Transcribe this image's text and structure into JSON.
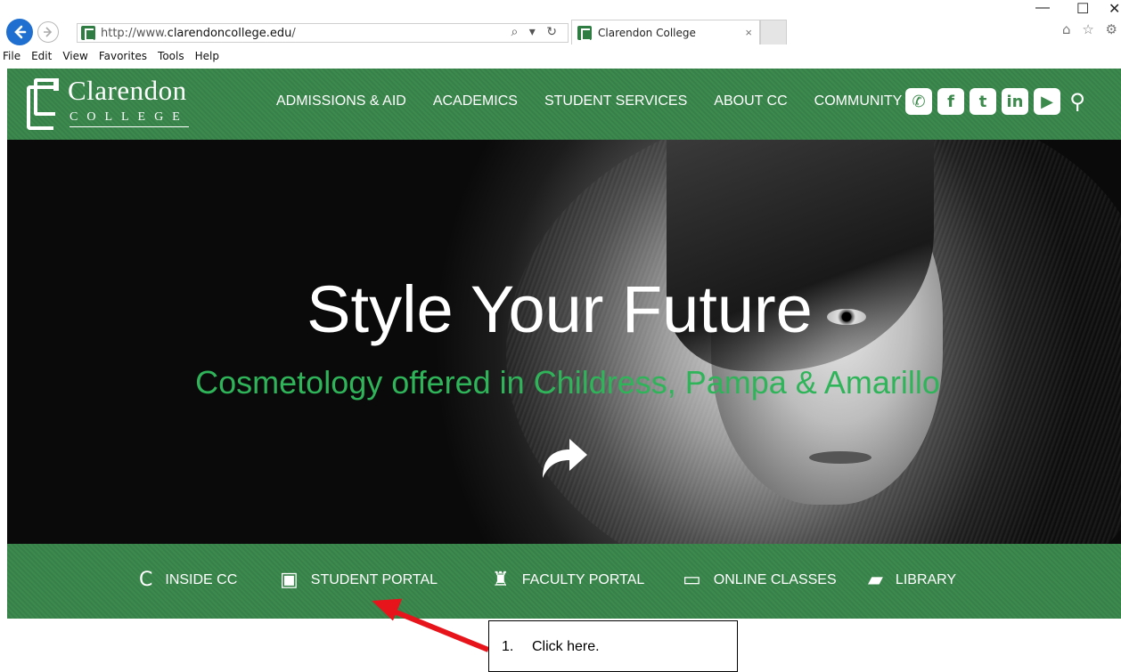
{
  "browser": {
    "url_prefix": "http://www.",
    "url_domain": "clarendoncollege.edu",
    "url_suffix": "/",
    "address_tools": "⌕ ▾ ↻",
    "tab_title": "Clarendon College",
    "tab_close": "×",
    "window_controls": {
      "minimize": "—",
      "maximize": "☐",
      "close": "✕"
    },
    "toolbar_icons": "⌂ ☆ ⚙",
    "menu": [
      "File",
      "Edit",
      "View",
      "Favorites",
      "Tools",
      "Help"
    ]
  },
  "site": {
    "logo_name": "Clarendon",
    "logo_sub": "COLLEGE",
    "nav": [
      "ADMISSIONS & AID",
      "ACADEMICS",
      "STUDENT SERVICES",
      "ABOUT CC",
      "COMMUNITY"
    ],
    "social": {
      "phone": "✆",
      "facebook": "f",
      "twitter": "t",
      "linkedin": "in",
      "youtube": "▶",
      "search": "⚲"
    },
    "hero": {
      "title": "Style Your Future",
      "subtitle": "Cosmetology offered in Childress, Pampa & Amarillo"
    },
    "quick_links": [
      {
        "label": "INSIDE CC",
        "icon": "C"
      },
      {
        "label": "STUDENT PORTAL",
        "icon": "▣"
      },
      {
        "label": "FACULTY PORTAL",
        "icon": "♜"
      },
      {
        "label": "ONLINE CLASSES",
        "icon": "▭"
      },
      {
        "label": "LIBRARY",
        "icon": "▰"
      }
    ]
  },
  "annotation": {
    "number": "1.",
    "text": "Click here."
  },
  "colors": {
    "brand_green": "#3d8a4d",
    "hero_subtitle": "#2fb45a",
    "browser_back": "#1f6fd1",
    "annotation_arrow": "#e8141c"
  }
}
